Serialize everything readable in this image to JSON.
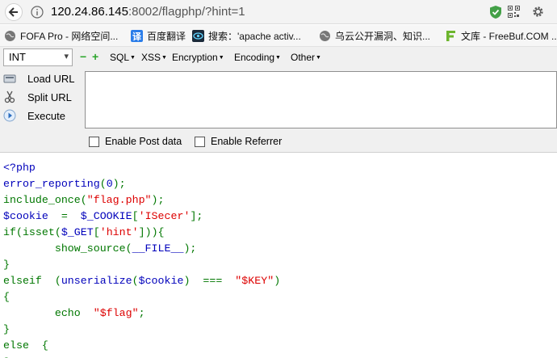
{
  "browser": {
    "url_host": "120.24.86.145",
    "url_rest": ":8002/flagphp/?hint=1",
    "icons": {
      "back": "back-arrow-icon",
      "info": "info-icon",
      "shield": "shield-check-icon",
      "qr": "qr-code-icon",
      "menu": "gear-icon"
    }
  },
  "bookmarks": [
    {
      "label": "FOFA Pro - 网络空间...",
      "icon": "globe-icon"
    },
    {
      "label": "百度翻译",
      "icon": "translate-icon"
    },
    {
      "label": "搜索：'apache activ...",
      "icon": "eye-icon"
    },
    {
      "label": "乌云公开漏洞、知识...",
      "icon": "globe-icon"
    },
    {
      "label": "文库 - FreeBuf.COM ...",
      "icon": "freebuf-icon"
    }
  ],
  "hackbar": {
    "select_value": "INT",
    "menus": [
      "SQL",
      "XSS",
      "Encryption",
      "Encoding",
      "Other"
    ],
    "buttons": [
      "Load URL",
      "Split URL",
      "Execute"
    ],
    "url_value": "",
    "checkboxes": [
      "Enable Post data",
      "Enable Referrer"
    ]
  },
  "source_code": [
    [
      [
        "d",
        "<?php"
      ]
    ],
    [
      [
        "d",
        "error_reporting"
      ],
      [
        "k",
        "("
      ],
      [
        "d",
        "0"
      ],
      [
        "k",
        ");"
      ]
    ],
    [
      [
        "k",
        "include_once("
      ],
      [
        "s",
        "\"flag.php\""
      ],
      [
        "k",
        ");"
      ]
    ],
    [
      [
        "d",
        "$cookie"
      ],
      [
        "k",
        "  =  "
      ],
      [
        "d",
        "$_COOKIE"
      ],
      [
        "k",
        "["
      ],
      [
        "s",
        "'ISecer'"
      ],
      [
        "k",
        "];"
      ]
    ],
    [
      [
        "k",
        "if(isset("
      ],
      [
        "d",
        "$_GET"
      ],
      [
        "k",
        "["
      ],
      [
        "s",
        "'hint'"
      ],
      [
        "k",
        "])){"
      ]
    ],
    [
      [
        "k",
        "        show_source("
      ],
      [
        "d",
        "__FILE__"
      ],
      [
        "k",
        ");"
      ]
    ],
    [
      [
        "k",
        "}"
      ]
    ],
    [
      [
        "k",
        "elseif  ("
      ],
      [
        "d",
        "unserialize"
      ],
      [
        "k",
        "("
      ],
      [
        "d",
        "$cookie"
      ],
      [
        "k",
        ")  ===  "
      ],
      [
        "s",
        "\"$KEY\""
      ],
      [
        "k",
        ")"
      ]
    ],
    [
      [
        "k",
        "{"
      ]
    ],
    [
      [
        "k",
        "        echo  "
      ],
      [
        "s",
        "\"$flag\""
      ],
      [
        "k",
        ";"
      ]
    ],
    [
      [
        "k",
        "}"
      ]
    ],
    [
      [
        "k",
        "else  {"
      ]
    ],
    [
      [
        "k",
        "?>"
      ]
    ]
  ]
}
